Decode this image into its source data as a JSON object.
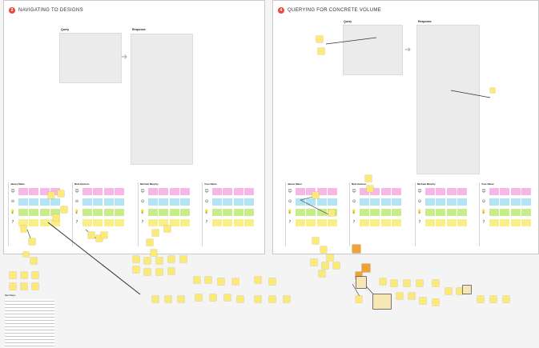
{
  "sections": [
    {
      "number": "3",
      "title": "NAVIGATING TO DESIGNS",
      "query_label": "Query",
      "response_label": "Response"
    },
    {
      "number": "4",
      "title": "QUERYING FOR CONCRETE VOLUME",
      "query_label": "Query",
      "response_label": "Response"
    }
  ],
  "persona_columns": [
    "James Mann",
    "Nick Hudson",
    "Michael Murphy",
    "Your Name",
    "James Mann",
    "Nick Hudson",
    "Michael Murphy",
    "Your Name"
  ],
  "row_icons": [
    "☺",
    "⊙",
    "💡",
    "?"
  ],
  "colors": {
    "pink": "#f6b8e6",
    "blue": "#b2e4f4",
    "green": "#c9ec8a",
    "yellow": "#f8ee8a",
    "sticky": "#fbe97a",
    "orange": "#f0a23a",
    "number_badge": "#e8493a",
    "arrow": "#b5b5b5"
  },
  "notes_panel_title": "Next Steps"
}
